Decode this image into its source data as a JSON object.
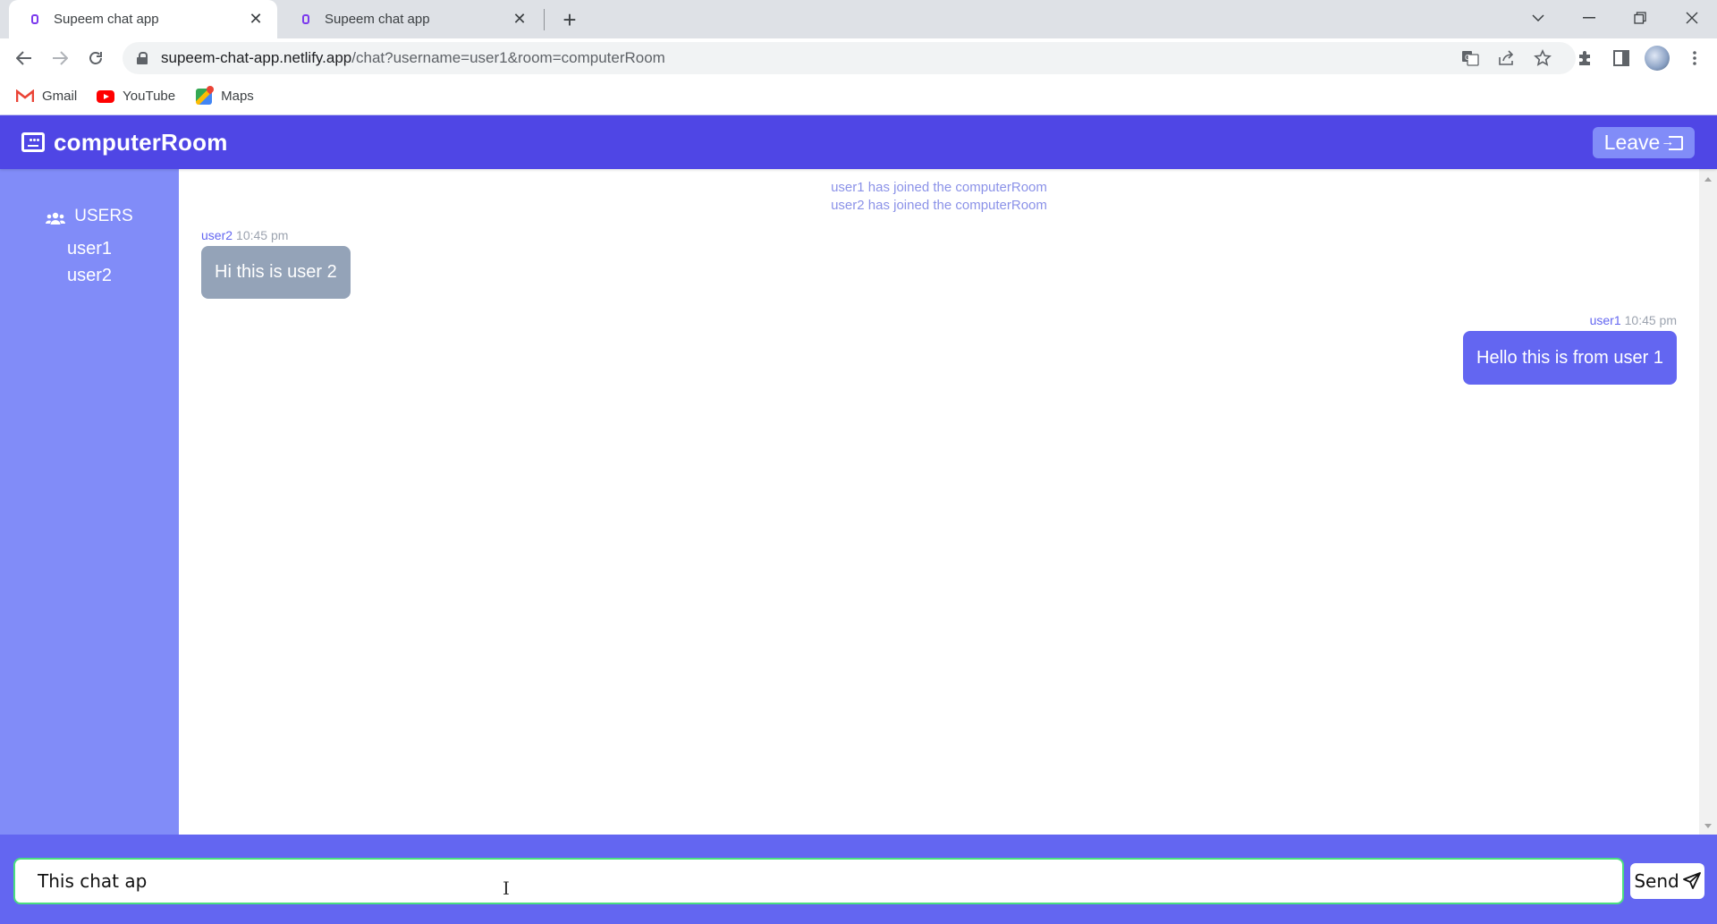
{
  "browser": {
    "tabs": [
      {
        "title": "Supeem chat app",
        "active": true
      },
      {
        "title": "Supeem chat app",
        "active": false
      }
    ],
    "new_tab_label": "+",
    "url_host": "supeem-chat-app.netlify.app",
    "url_path": "/chat?username=user1&room=computerRoom",
    "bookmarks": [
      {
        "label": "Gmail",
        "icon": "gmail-icon"
      },
      {
        "label": "YouTube",
        "icon": "youtube-icon"
      },
      {
        "label": "Maps",
        "icon": "maps-icon"
      }
    ]
  },
  "app": {
    "room_name": "computerRoom",
    "leave_label": "Leave",
    "sidebar": {
      "heading": "USERS",
      "users": [
        "user1",
        "user2"
      ]
    },
    "notices": [
      "user1 has joined the computerRoom",
      "user2 has joined the computerRoom"
    ],
    "messages": [
      {
        "user": "user2",
        "time": "10:45 pm",
        "text": "Hi this is user 2",
        "mine": false
      },
      {
        "user": "user1",
        "time": "10:45 pm",
        "text": "Hello this is from user 1",
        "mine": true
      }
    ],
    "composer": {
      "value": "This chat ap",
      "send_label": "Send"
    },
    "colors": {
      "header": "#4f46e5",
      "sidebar": "#818cf8",
      "footer": "#6366f1",
      "own_bubble": "#6366f1",
      "other_bubble": "#94a3b8",
      "input_border": "#4ade80"
    }
  }
}
